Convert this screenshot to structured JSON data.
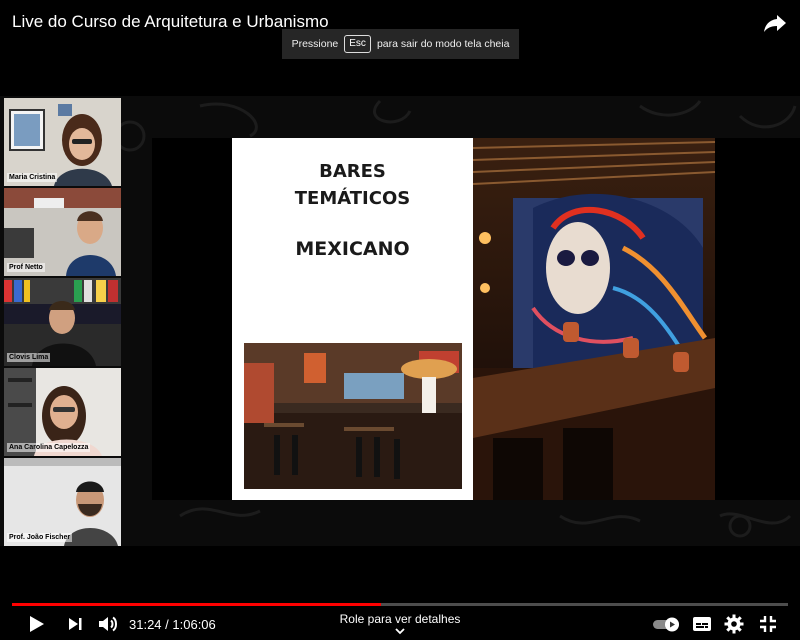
{
  "video": {
    "title": "Live do Curso de Arquitetura e Urbanismo"
  },
  "fullscreen_toast": {
    "prefix": "Pressione",
    "key": "Esc",
    "suffix": "para sair do modo tela cheia"
  },
  "participants": [
    {
      "name": "Maria Cristina"
    },
    {
      "name": "Prof Netto"
    },
    {
      "name": "Clovis Lima"
    },
    {
      "name": "Ana Carolina Capelozza"
    },
    {
      "name": "Prof. João Fischer"
    }
  ],
  "slide": {
    "heading_line1": "BARES",
    "heading_line2": "TEMÁTICOS",
    "subheading": "MEXICANO"
  },
  "player": {
    "current_time": "31:24",
    "separator": " / ",
    "duration": "1:06:06",
    "progress_fraction": 0.475,
    "buffered_fraction": 0.475,
    "swipe_hint": "Role para ver detalhes",
    "accent_color": "#ff0000",
    "icons": [
      "play-icon",
      "next-icon",
      "volume-icon",
      "autoplay-toggle-icon",
      "subtitles-icon",
      "settings-icon",
      "exit-fullscreen-icon",
      "share-icon"
    ]
  }
}
